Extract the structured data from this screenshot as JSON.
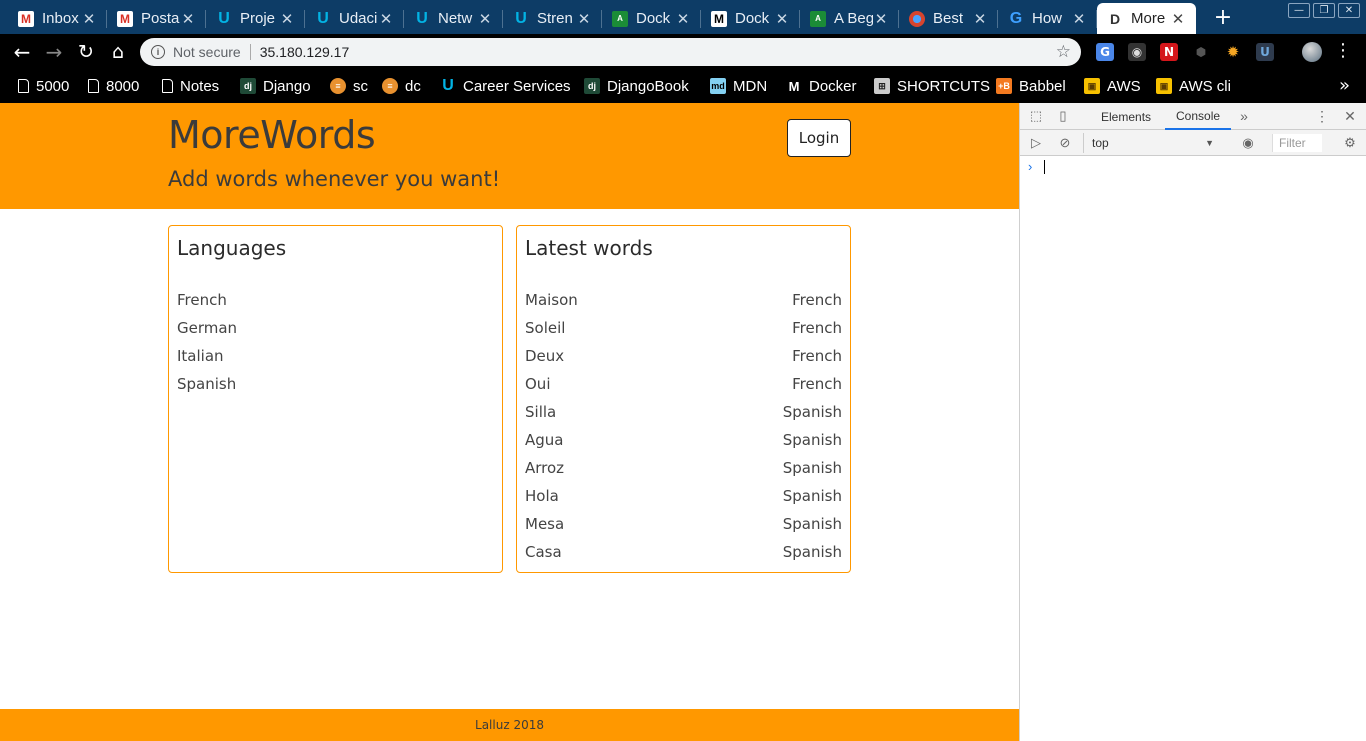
{
  "browser": {
    "tabs": [
      {
        "title": "Inbox",
        "icon": "gmail-icon",
        "glyph": "M"
      },
      {
        "title": "Posta",
        "icon": "gmail-icon",
        "glyph": "M"
      },
      {
        "title": "Proje",
        "icon": "udacity-icon",
        "glyph": "U"
      },
      {
        "title": "Udaci",
        "icon": "udacity-icon",
        "glyph": "U"
      },
      {
        "title": "Netw",
        "icon": "udacity-icon",
        "glyph": "U"
      },
      {
        "title": "Stren",
        "icon": "udacity-icon",
        "glyph": "U"
      },
      {
        "title": "Dock",
        "icon": "docker-guide-icon",
        "glyph": "A"
      },
      {
        "title": "Dock",
        "icon": "medium-icon",
        "glyph": "M"
      },
      {
        "title": "A Beg",
        "icon": "docker-guide-icon",
        "glyph": "A"
      },
      {
        "title": "Best",
        "icon": "globe-icon",
        "glyph": ""
      },
      {
        "title": "How",
        "icon": "loop-icon",
        "glyph": "G"
      },
      {
        "title": "More",
        "icon": "document-icon",
        "glyph": "D"
      }
    ],
    "close_glyph": "✕",
    "new_tab_glyph": "+",
    "address": {
      "security_label": "Not secure",
      "url": "35.180.129.17"
    },
    "bookmarks": [
      {
        "label": "5000",
        "icon": "page-icon",
        "glyph": ""
      },
      {
        "label": "8000",
        "icon": "page-icon",
        "glyph": ""
      },
      {
        "label": "Notes",
        "icon": "page-icon",
        "glyph": ""
      },
      {
        "label": "Django",
        "icon": "django-icon",
        "glyph": "dj"
      },
      {
        "label": "sc",
        "icon": "stack-icon",
        "glyph": "≡"
      },
      {
        "label": "dc",
        "icon": "stack-icon",
        "glyph": "≡"
      },
      {
        "label": "Career Services",
        "icon": "udacity-icon",
        "glyph": "U"
      },
      {
        "label": "DjangoBook",
        "icon": "djangobook-icon",
        "glyph": "dj"
      },
      {
        "label": "MDN",
        "icon": "mdn-icon",
        "glyph": "md"
      },
      {
        "label": "Docker",
        "icon": "medium-icon",
        "glyph": "M"
      },
      {
        "label": "SHORTCUTS",
        "icon": "grid-icon",
        "glyph": "⊞"
      },
      {
        "label": "Babbel",
        "icon": "babbel-icon",
        "glyph": "+B"
      },
      {
        "label": "AWS",
        "icon": "aws-icon",
        "glyph": "▣"
      },
      {
        "label": "AWS cli",
        "icon": "aws-icon",
        "glyph": "▣"
      }
    ]
  },
  "site": {
    "title": "MoreWords",
    "tagline": "Add words whenever you want!",
    "login_label": "Login",
    "languages": {
      "heading": "Languages",
      "items": [
        "French",
        "German",
        "Italian",
        "Spanish"
      ]
    },
    "latest_words": {
      "heading": "Latest words",
      "items": [
        {
          "word": "Maison",
          "language": "French"
        },
        {
          "word": "Soleil",
          "language": "French"
        },
        {
          "word": "Deux",
          "language": "French"
        },
        {
          "word": "Oui",
          "language": "French"
        },
        {
          "word": "Silla",
          "language": "Spanish"
        },
        {
          "word": "Agua",
          "language": "Spanish"
        },
        {
          "word": "Arroz",
          "language": "Spanish"
        },
        {
          "word": "Hola",
          "language": "Spanish"
        },
        {
          "word": "Mesa",
          "language": "Spanish"
        },
        {
          "word": "Casa",
          "language": "Spanish"
        }
      ]
    },
    "footer": "Lalluz 2018",
    "colors": {
      "accent": "#ff9800",
      "text": "#3b3b3b"
    }
  },
  "devtools": {
    "tabs": [
      "Elements",
      "Console"
    ],
    "active_tab": "Console",
    "context": "top",
    "filter_placeholder": "Filter",
    "prompt_glyph": "›"
  }
}
